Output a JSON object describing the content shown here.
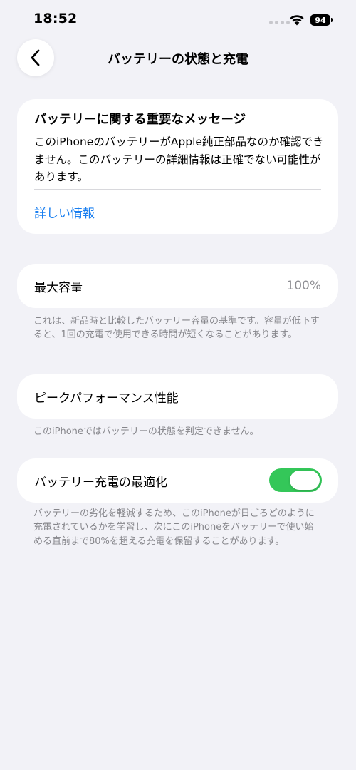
{
  "status_bar": {
    "time": "18:52",
    "battery_level": "94"
  },
  "nav": {
    "title": "バッテリーの状態と充電"
  },
  "message_card": {
    "title": "バッテリーに関する重要なメッセージ",
    "body": "このiPhoneのバッテリーがApple純正部品なのか確認できません。このバッテリーの詳細情報は正確でない可能性があります。",
    "link_label": "詳しい情報"
  },
  "max_capacity": {
    "label": "最大容量",
    "value": "100%",
    "footnote": "これは、新品時と比較したバッテリー容量の基準です。容量が低下すると、1回の充電で使用できる時間が短くなることがあります。"
  },
  "peak_performance": {
    "label": "ピークパフォーマンス性能",
    "footnote": "このiPhoneではバッテリーの状態を判定できません。"
  },
  "optimized_charging": {
    "label": "バッテリー充電の最適化",
    "enabled": true,
    "footnote": "バッテリーの劣化を軽減するため、このiPhoneが日ごろどのように充電されているかを学習し、次にこのiPhoneをバッテリーで使い始める直前まで80%を超える充電を保留することがあります。"
  },
  "colors": {
    "background": "#f2f2f7",
    "link": "#1a7ff0",
    "toggle_on": "#34c759",
    "secondary_text": "#86868b"
  },
  "icons": [
    "wifi-icon",
    "battery-icon",
    "chevron-left-icon"
  ]
}
